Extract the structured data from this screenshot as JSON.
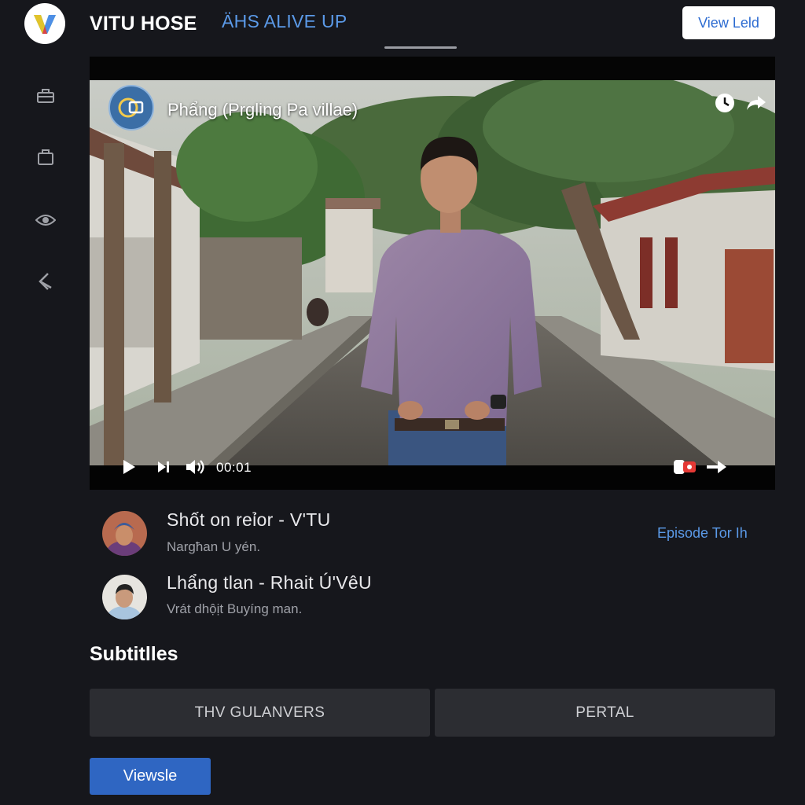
{
  "header": {
    "app_title": "VITU HOSE",
    "nav_link": "ÄHS ALIVE UP",
    "view_button": "View Leld"
  },
  "sidebar": {
    "icons": [
      "toolbox-icon",
      "briefcase-icon",
      "eye-icon",
      "back-arrow-icon"
    ]
  },
  "player": {
    "title": "Phẩng (Prgling Pa villae)",
    "time": "00:01",
    "progress_fraction": 0.1,
    "top_controls": [
      "clock-icon",
      "share-icon"
    ],
    "bottom_right_controls": [
      "subtitles-icon",
      "next-arrow-icon"
    ]
  },
  "episodes": [
    {
      "title": "Shốt on reỉor - V'TU",
      "subtitle": "Nargħan U yén."
    },
    {
      "title": "Lhẩng tlan - Rhait Ú'VêU",
      "subtitle": "Vrát dhộịt Buyíng man."
    }
  ],
  "episode_link": "Episode Tor Ih",
  "subtitles": {
    "heading": "Subtitlles",
    "options": [
      "THV GULANVERS",
      "PERTAL"
    ],
    "action_button": "Viewsle"
  },
  "colors": {
    "background": "#16171c",
    "accent_blue": "#5b9ae8",
    "button_blue": "#2f66c2",
    "progress_red": "#e53935"
  }
}
